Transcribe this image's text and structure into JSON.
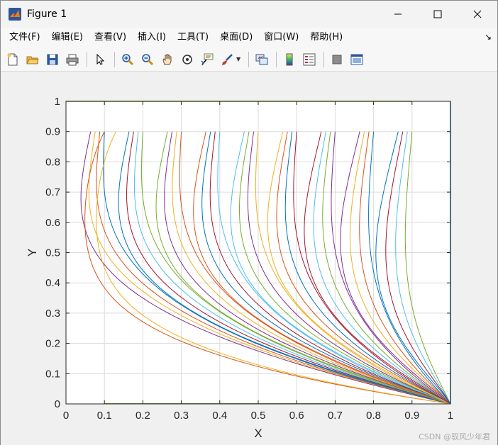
{
  "window": {
    "title": "Figure 1"
  },
  "menu": {
    "items": [
      "文件(F)",
      "编辑(E)",
      "查看(V)",
      "插入(I)",
      "工具(T)",
      "桌面(D)",
      "窗口(W)",
      "帮助(H)"
    ]
  },
  "toolbar": {
    "groups": [
      [
        "new-figure-icon",
        "open-file-icon",
        "save-icon",
        "print-icon"
      ],
      [
        "pointer-icon"
      ],
      [
        "zoom-in-icon",
        "zoom-out-icon",
        "pan-hand-icon",
        "rotate-3d-icon",
        "data-cursor-icon",
        "brush-icon"
      ],
      [
        "link-plot-icon"
      ],
      [
        "colorbar-icon",
        "legend-icon"
      ],
      [
        "hide-plot-tools-icon",
        "show-plot-tools-icon"
      ]
    ]
  },
  "chart_data": {
    "type": "line",
    "title": "",
    "xlabel": "X",
    "ylabel": "Y",
    "xlim": [
      0,
      1
    ],
    "ylim": [
      0,
      1
    ],
    "xticks": [
      "0",
      "0.1",
      "0.2",
      "0.3",
      "0.4",
      "0.5",
      "0.6",
      "0.7",
      "0.8",
      "0.9",
      "1"
    ],
    "yticks": [
      "0",
      "0.1",
      "0.2",
      "0.3",
      "0.4",
      "0.5",
      "0.6",
      "0.7",
      "0.8",
      "0.9",
      "1"
    ],
    "grid": true,
    "colors": [
      "#0072BD",
      "#D95319",
      "#EDB120",
      "#7E2F8E",
      "#77AC30",
      "#4DBEEE",
      "#A2142F"
    ],
    "series_description": "family of curves, each starting at top (y=0.9) at x = 0.1..0.9, bulging left and converging to (1, 0)",
    "start_x": [
      0.1,
      0.2,
      0.3,
      0.4,
      0.5,
      0.6,
      0.7,
      0.8,
      0.9
    ],
    "boundary": {
      "top_y": 1,
      "right_x": 1
    }
  },
  "watermark": "CSDN @驭风少年君"
}
